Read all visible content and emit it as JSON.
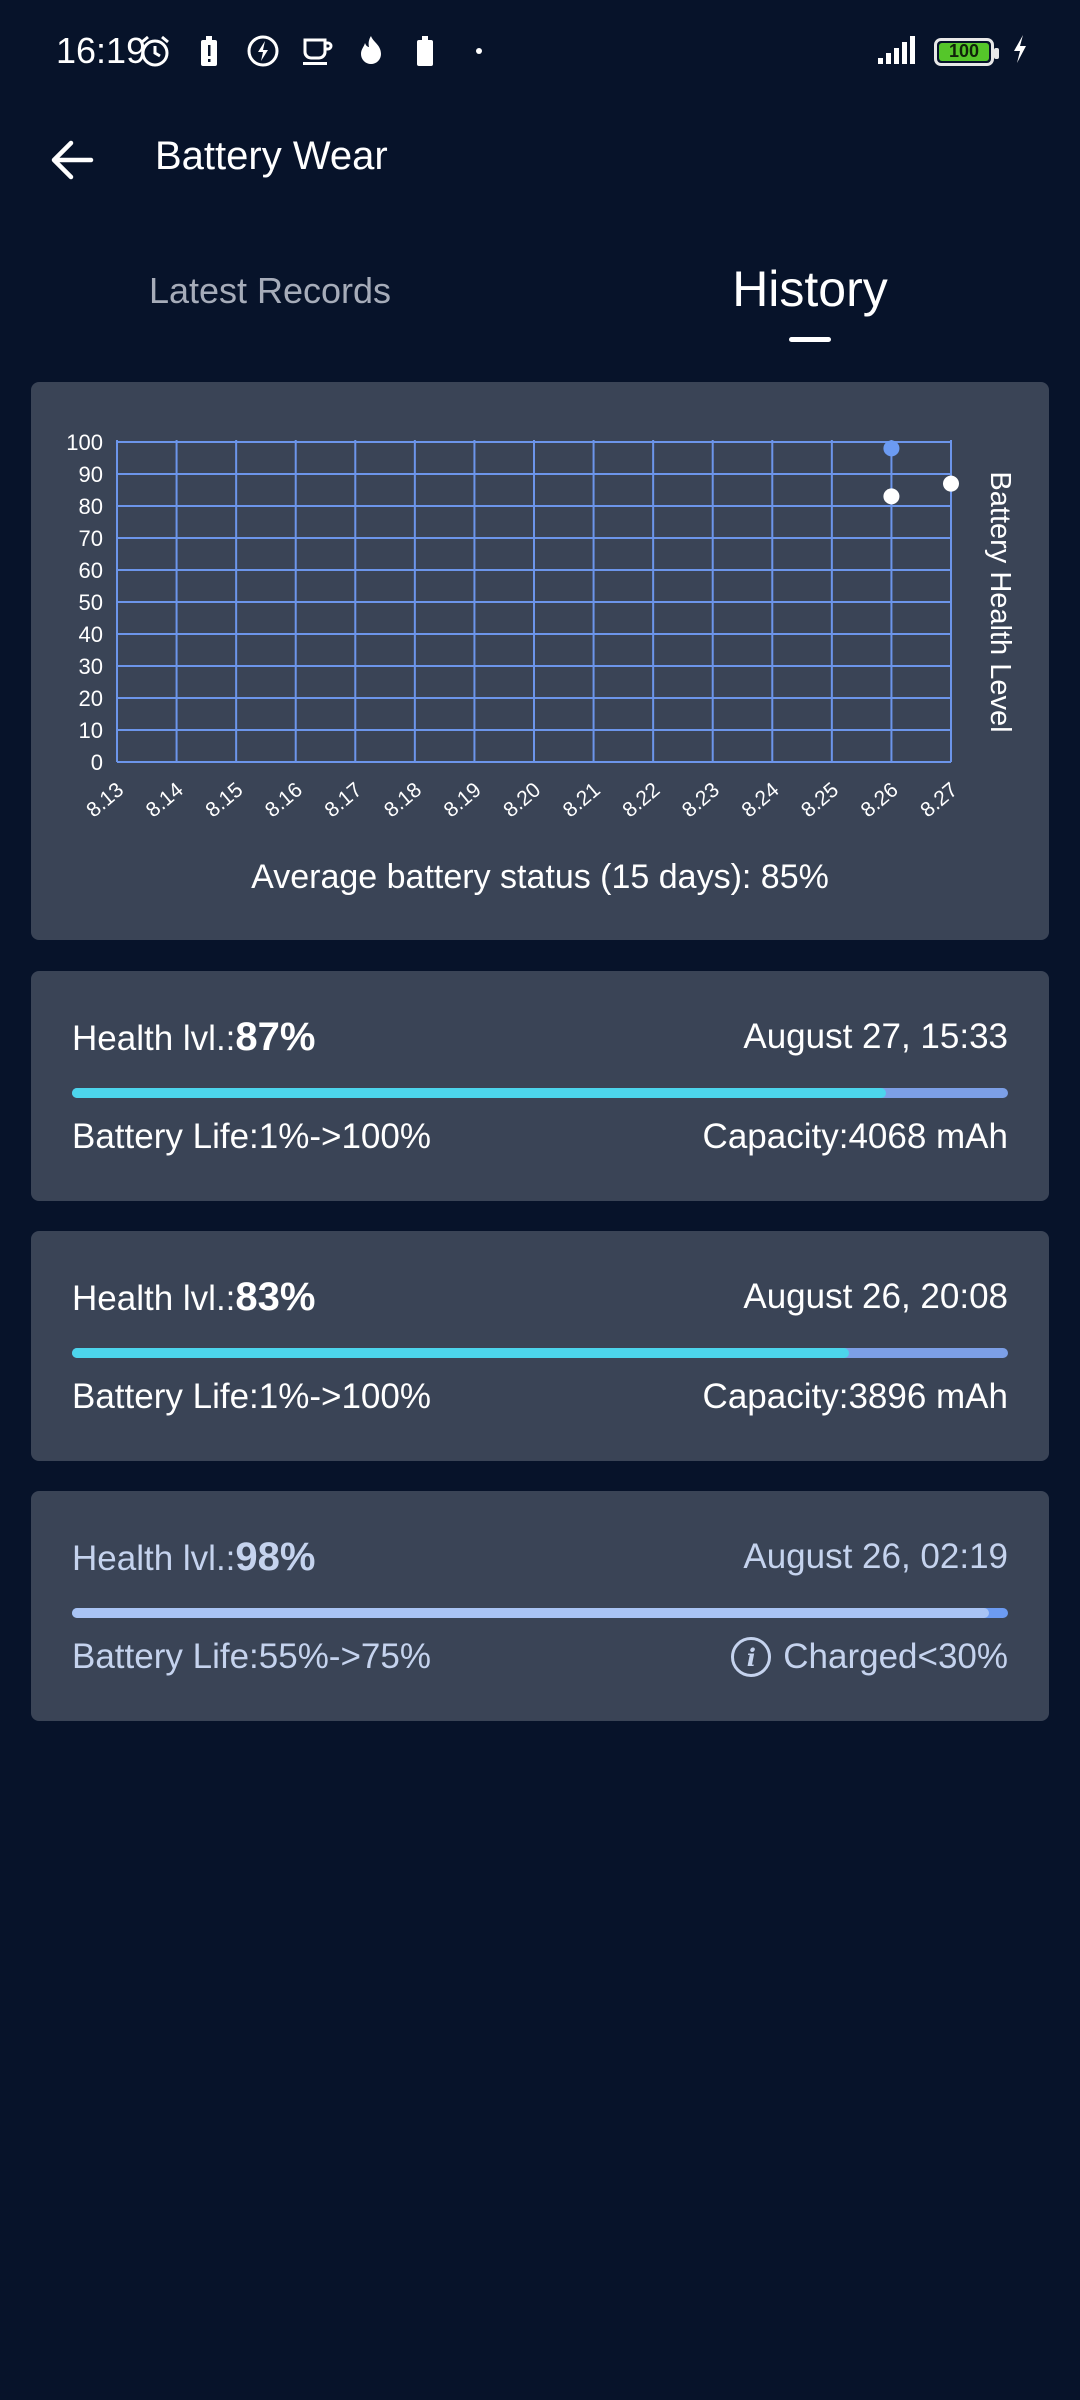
{
  "status_bar": {
    "time": "16:19",
    "battery_level": "100",
    "icons": [
      "alarm-icon",
      "battery-alert-icon",
      "flash-icon",
      "coffee-icon",
      "flame-icon",
      "battery-icon",
      "dot-icon",
      "signal-icon",
      "charging-bolt-icon"
    ]
  },
  "app_bar": {
    "title": "Battery Wear",
    "back_icon": "arrow-left-icon"
  },
  "tabs": [
    {
      "label": "Latest Records",
      "active": false
    },
    {
      "label": "History",
      "active": true
    }
  ],
  "chart": {
    "avg_text": "Average battery status (15 days): 85%"
  },
  "chart_data": {
    "type": "scatter",
    "categories": [
      "8.13",
      "8.14",
      "8.15",
      "8.16",
      "8.17",
      "8.18",
      "8.19",
      "8.20",
      "8.21",
      "8.22",
      "8.23",
      "8.24",
      "8.25",
      "8.26",
      "8.27"
    ],
    "y_ticks": [
      "0",
      "10",
      "20",
      "30",
      "40",
      "50",
      "60",
      "70",
      "80",
      "90",
      "100"
    ],
    "ylim": [
      0,
      100
    ],
    "ylabel": "Battery Health Level",
    "grid": true,
    "points": [
      {
        "x": "8.26",
        "y": 98,
        "color": "#6c9bf2"
      },
      {
        "x": "8.26",
        "y": 83,
        "color": "#ffffff"
      },
      {
        "x": "8.27",
        "y": 87,
        "color": "#ffffff"
      }
    ]
  },
  "records": [
    {
      "health_label": "Health lvl.:",
      "health_value": "87%",
      "health_fraction": 0.87,
      "date": "August 27, 15:33",
      "life": "Battery Life:1%->100%",
      "capacity": "Capacity:4068 mAh",
      "fill_color": "#4cd5ec",
      "track_color": "#7c9fe6",
      "text_color": "#ffffff",
      "show_info_icon": false
    },
    {
      "health_label": "Health lvl.:",
      "health_value": "83%",
      "health_fraction": 0.83,
      "date": "August 26, 20:08",
      "life": "Battery Life:1%->100%",
      "capacity": "Capacity:3896 mAh",
      "fill_color": "#4cd5ec",
      "track_color": "#7c9fe6",
      "text_color": "#ffffff",
      "show_info_icon": false
    },
    {
      "health_label": "Health lvl.:",
      "health_value": "98%",
      "health_fraction": 0.98,
      "date": "August 26, 02:19",
      "life": "Battery Life:55%->75%",
      "capacity": "Charged<30%",
      "fill_color": "#a9c4f5",
      "track_color": "#6c9bf2",
      "text_color": "#c5d3ee",
      "show_info_icon": true
    }
  ]
}
